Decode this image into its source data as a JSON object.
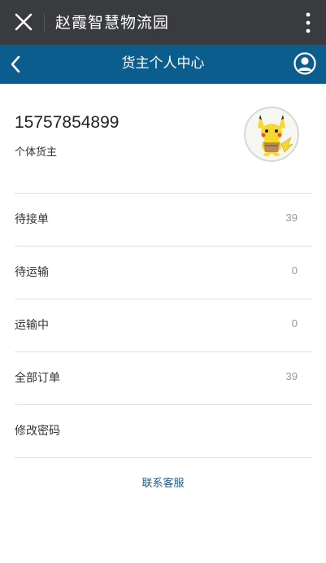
{
  "app": {
    "title": "赵霞智慧物流园",
    "close_icon": "close-icon",
    "more_icon": "more-vertical-icon"
  },
  "nav": {
    "title": "货主个人中心",
    "back_icon": "chevron-left-icon",
    "user_icon": "user-circle-icon"
  },
  "profile": {
    "phone": "15757854899",
    "role": "个体货主",
    "avatar_icon": "pikachu-avatar-icon"
  },
  "menu": {
    "items": [
      {
        "label": "待接单",
        "count": "39"
      },
      {
        "label": "待运输",
        "count": "0"
      },
      {
        "label": "运输中",
        "count": "0"
      },
      {
        "label": "全部订单",
        "count": "39"
      },
      {
        "label": "修改密码",
        "count": ""
      }
    ]
  },
  "footer": {
    "contact_label": "联系客服"
  },
  "colors": {
    "topbar": "#3a3b3f",
    "navbar": "#0a5d8c",
    "link": "#1f5a86"
  }
}
